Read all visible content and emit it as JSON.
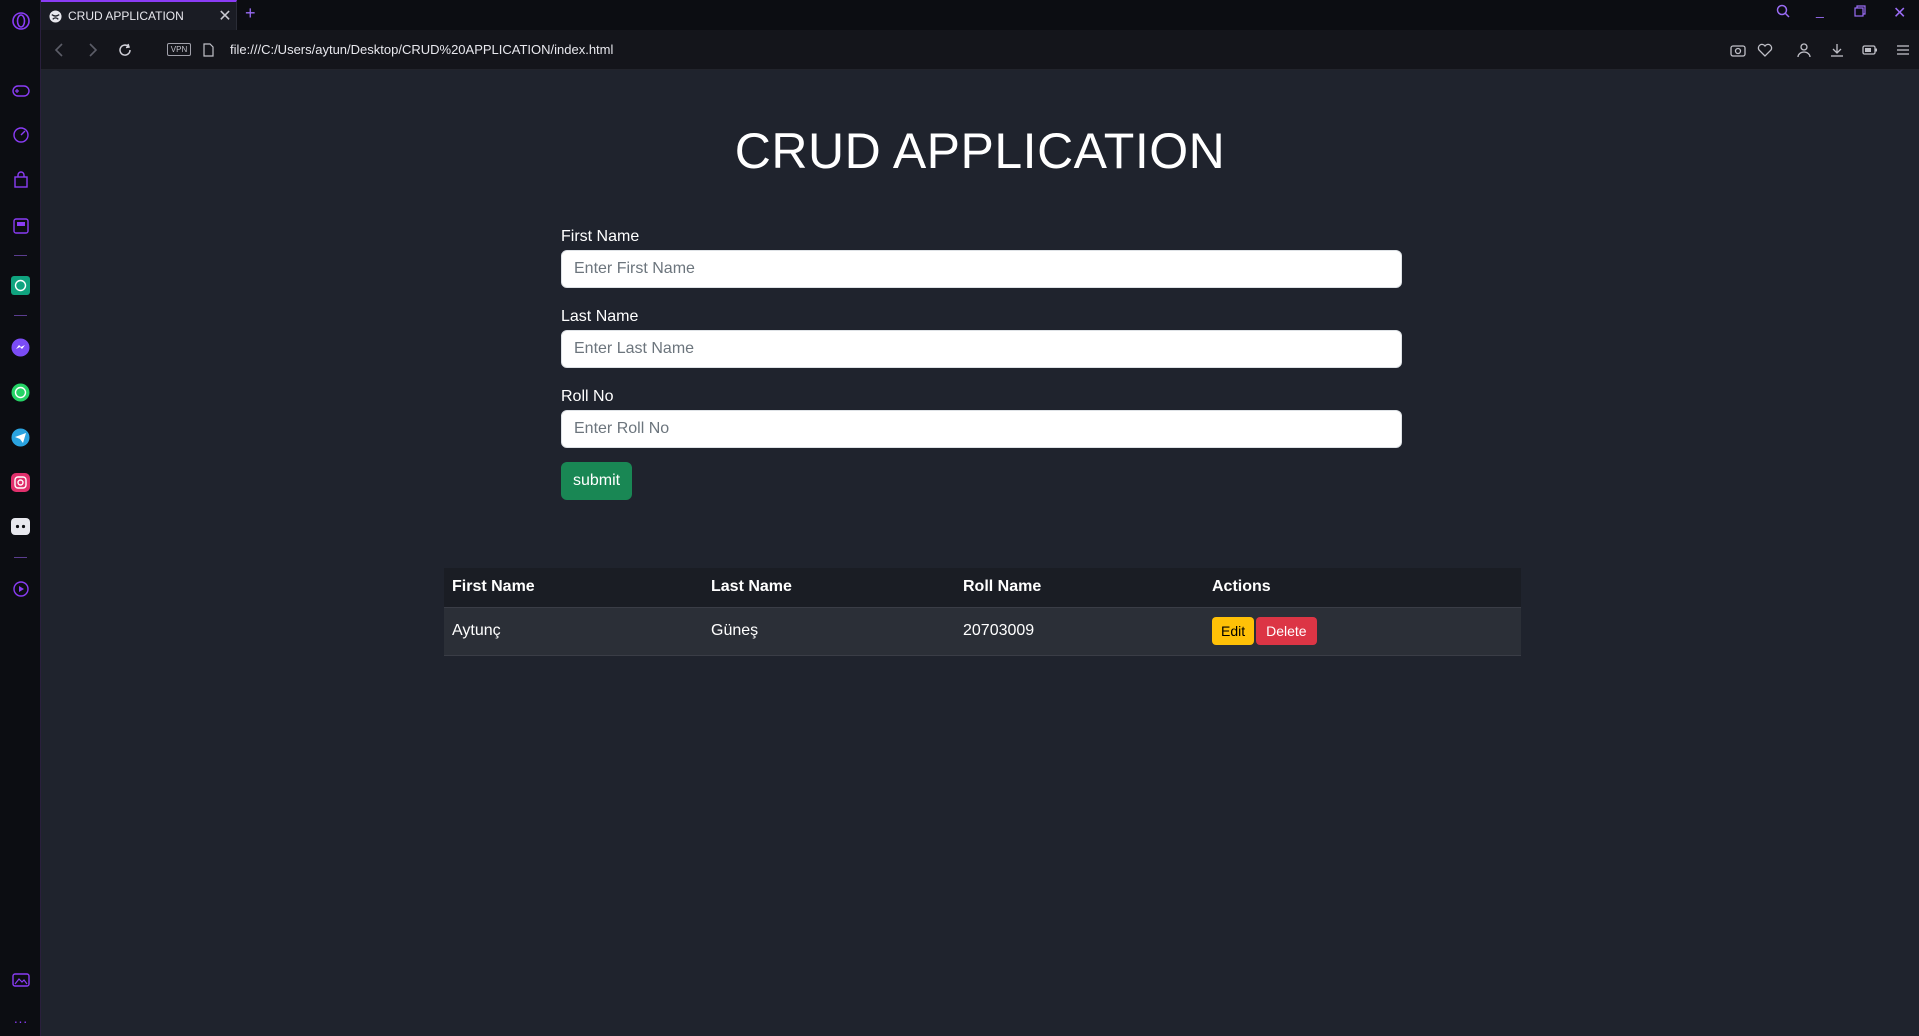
{
  "browser": {
    "tab_title": "CRUD APPLICATION",
    "url": "file:///C:/Users/aytun/Desktop/CRUD%20APPLICATION/index.html",
    "vpn_label": "VPN",
    "accent_color": "#8a3cf5"
  },
  "sidebar": {
    "icons": [
      "opera-logo-icon",
      "gamepad-icon",
      "speed-dial-icon",
      "bag-icon",
      "news-icon",
      "chatgpt-icon",
      "messenger-icon",
      "whatsapp-icon",
      "telegram-icon",
      "instagram-icon",
      "discord-icon",
      "player-icon",
      "gallery-icon",
      "more-icon"
    ],
    "more_label": "···"
  },
  "page": {
    "title": "CRUD APPLICATION",
    "form": {
      "first_name_label": "First Name",
      "first_name_placeholder": "Enter First Name",
      "last_name_label": "Last Name",
      "last_name_placeholder": "Enter Last Name",
      "roll_no_label": "Roll No",
      "roll_no_placeholder": "Enter Roll No",
      "submit_label": "submit"
    },
    "table": {
      "headers": [
        "First Name",
        "Last Name",
        "Roll Name",
        "Actions"
      ],
      "rows": [
        {
          "first_name": "Aytunç",
          "last_name": "Güneş",
          "roll": "20703009",
          "edit_label": "Edit",
          "delete_label": "Delete"
        }
      ]
    }
  }
}
